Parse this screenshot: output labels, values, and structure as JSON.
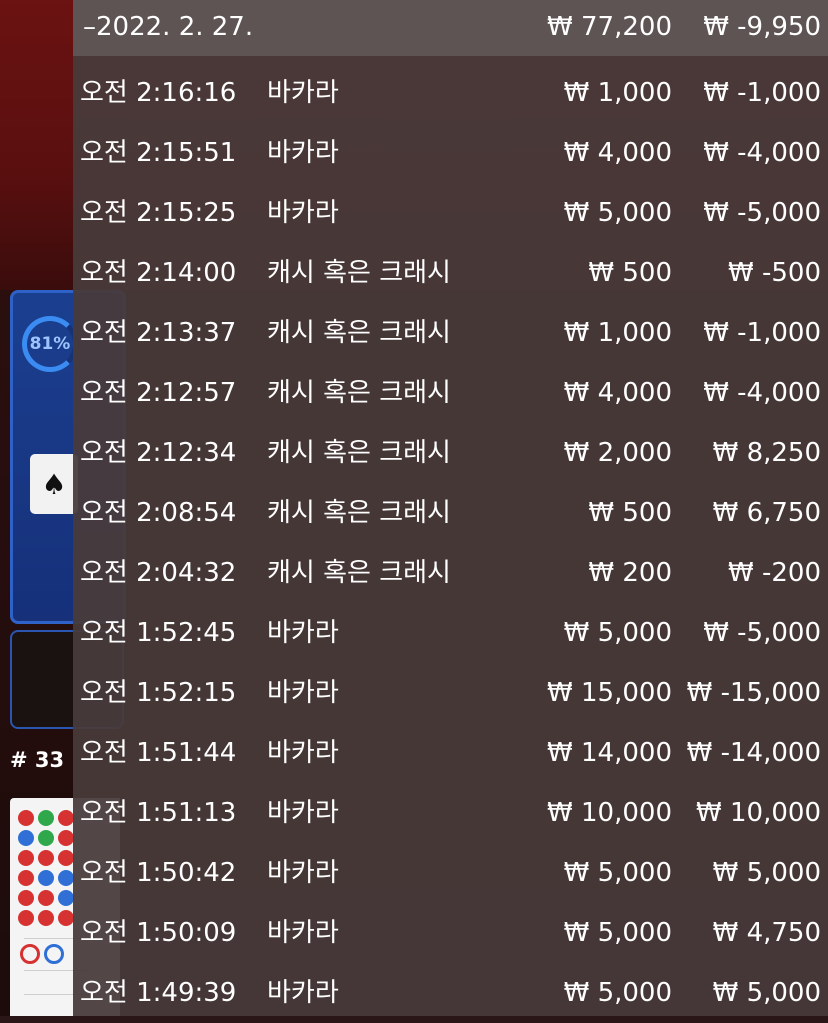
{
  "background": {
    "progress_percent": "81%",
    "card_symbol": "♠",
    "round_label": "# 33"
  },
  "history": {
    "header": {
      "date": "–2022. 2. 27.",
      "total_bet": "₩ 77,200",
      "net_result": "₩ -9,950"
    },
    "rows": [
      {
        "time": "오전 2:16:16",
        "game": "바카라",
        "bet": "₩ 1,000",
        "result": "₩ -1,000"
      },
      {
        "time": "오전 2:15:51",
        "game": "바카라",
        "bet": "₩ 4,000",
        "result": "₩ -4,000"
      },
      {
        "time": "오전 2:15:25",
        "game": "바카라",
        "bet": "₩ 5,000",
        "result": "₩ -5,000"
      },
      {
        "time": "오전 2:14:00",
        "game": "캐시 혹은 크래시",
        "bet": "₩ 500",
        "result": "₩ -500"
      },
      {
        "time": "오전 2:13:37",
        "game": "캐시 혹은 크래시",
        "bet": "₩ 1,000",
        "result": "₩ -1,000"
      },
      {
        "time": "오전 2:12:57",
        "game": "캐시 혹은 크래시",
        "bet": "₩ 4,000",
        "result": "₩ -4,000"
      },
      {
        "time": "오전 2:12:34",
        "game": "캐시 혹은 크래시",
        "bet": "₩ 2,000",
        "result": "₩ 8,250"
      },
      {
        "time": "오전 2:08:54",
        "game": "캐시 혹은 크래시",
        "bet": "₩ 500",
        "result": "₩ 6,750"
      },
      {
        "time": "오전 2:04:32",
        "game": "캐시 혹은 크래시",
        "bet": "₩ 200",
        "result": "₩ -200"
      },
      {
        "time": "오전 1:52:45",
        "game": "바카라",
        "bet": "₩ 5,000",
        "result": "₩ -5,000"
      },
      {
        "time": "오전 1:52:15",
        "game": "바카라",
        "bet": "₩ 15,000",
        "result": "₩ -15,000"
      },
      {
        "time": "오전 1:51:44",
        "game": "바카라",
        "bet": "₩ 14,000",
        "result": "₩ -14,000"
      },
      {
        "time": "오전 1:51:13",
        "game": "바카라",
        "bet": "₩ 10,000",
        "result": "₩ 10,000"
      },
      {
        "time": "오전 1:50:42",
        "game": "바카라",
        "bet": "₩ 5,000",
        "result": "₩ 5,000"
      },
      {
        "time": "오전 1:50:09",
        "game": "바카라",
        "bet": "₩ 5,000",
        "result": "₩ 4,750"
      },
      {
        "time": "오전 1:49:39",
        "game": "바카라",
        "bet": "₩ 5,000",
        "result": "₩ 5,000"
      }
    ]
  }
}
